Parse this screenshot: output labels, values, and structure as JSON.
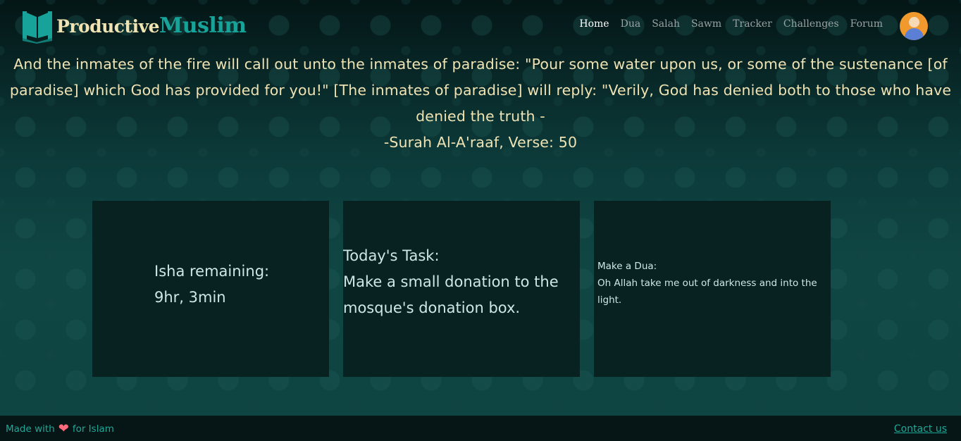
{
  "brand": {
    "part1": "Productive",
    "part2": "Muslim"
  },
  "nav": {
    "items": [
      "Home",
      "Dua",
      "Salah",
      "Sawm",
      "Tracker",
      "Challenges",
      "Forum"
    ],
    "active": "Home"
  },
  "quote": {
    "text": "And the inmates of the fire will call out unto the inmates of paradise: \"Pour some water upon us, or some of the sustenance [of paradise] which God has provided for you!\" [The inmates of paradise] will reply: \"Verily, God has denied both to those who have denied the truth -",
    "reference": "-Surah Al-A'raaf, Verse: 50"
  },
  "cards": {
    "prayer": {
      "line1": "Isha remaining:",
      "line2": "9hr, 3min"
    },
    "task": {
      "title": "Today's Task:",
      "body": "Make a small donation to the mosque's donation box."
    },
    "dua": {
      "title": "Make a Dua:",
      "body": "Oh Allah take me out of darkness and into the light."
    }
  },
  "footer": {
    "made_prefix": "Made with",
    "made_suffix": "for Islam",
    "contact": "Contact us"
  },
  "colors": {
    "accent": "#18a39a",
    "cream": "#efe3b3",
    "avatar": "#f2992e"
  },
  "icons": {
    "logo": "book-icon",
    "heart": "heart-icon",
    "avatar": "user-avatar-icon"
  }
}
